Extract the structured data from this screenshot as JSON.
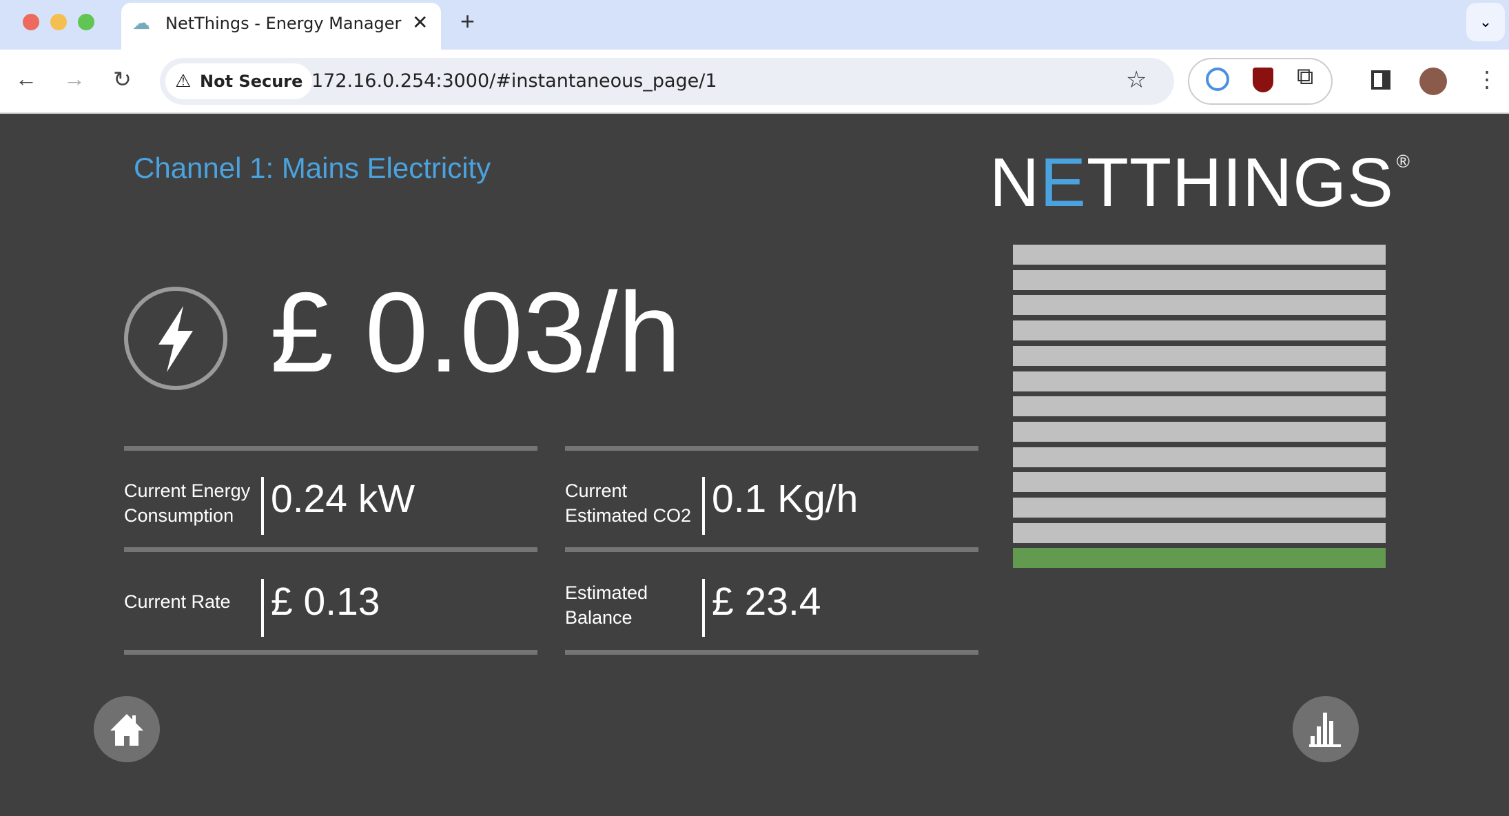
{
  "browser": {
    "tab_title": "NetThings - Energy Manager",
    "security_label": "Not Secure",
    "url": "172.16.0.254:3000/#instantaneous_page/1"
  },
  "page": {
    "channel_title": "Channel 1: Mains Electricity",
    "logo": "NETTHINGS",
    "cost_per_hour": "£ 0.03/h",
    "metrics": [
      {
        "label_line1": "Current Energy",
        "label_line2": "Consumption",
        "value": "0.24 kW"
      },
      {
        "label_line1": "Current",
        "label_line2": "Estimated CO2",
        "value": "0.1 Kg/h"
      },
      {
        "label_line1": "Current Rate",
        "label_line2": "",
        "value": "£ 0.13"
      },
      {
        "label_line1": "Estimated",
        "label_line2": "Balance",
        "value": "£ 23.4"
      }
    ],
    "usage_gauge": {
      "segments": 13,
      "active_segments": 1,
      "active_color": "#629b4f",
      "inactive_color": "#c0c0c0"
    },
    "accent_color": "#4aa3df"
  }
}
